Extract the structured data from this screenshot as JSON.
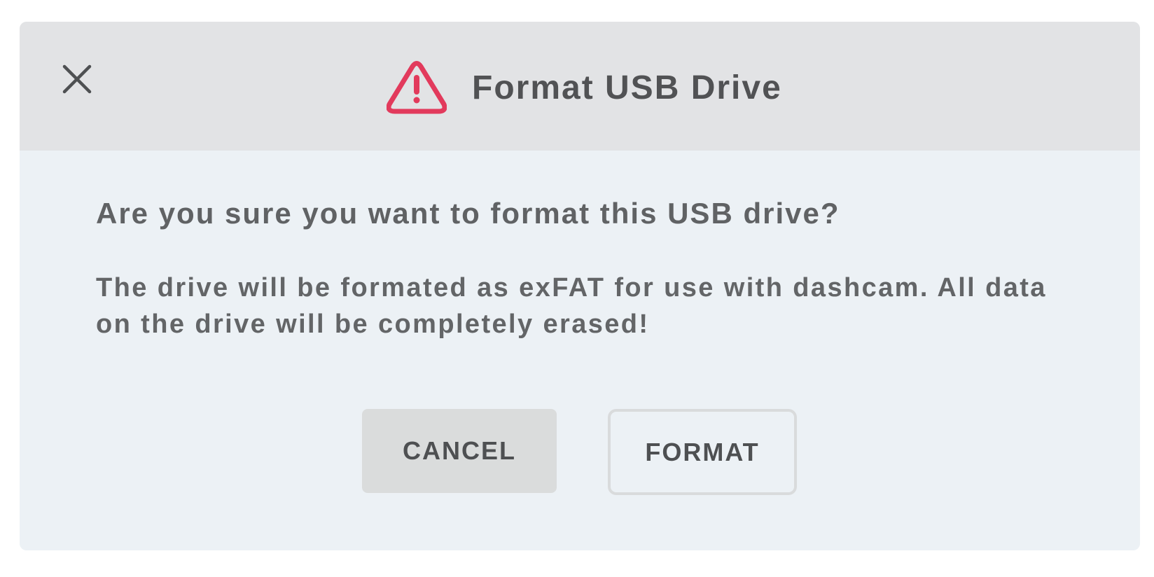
{
  "dialog": {
    "title": "Format USB Drive",
    "question": "Are you sure you want to format this USB drive?",
    "description": "The drive will be formated as exFAT for use with dashcam. All data on the drive will be completely erased!",
    "buttons": {
      "cancel_label": "CANCEL",
      "format_label": "FORMAT"
    },
    "icons": {
      "close": "close-icon",
      "warning": "warning-icon"
    },
    "colors": {
      "warning": "#e23a5c",
      "header_bg": "#e2e3e5",
      "body_bg": "#ecf1f5",
      "cancel_bg": "#dadcdc"
    }
  }
}
